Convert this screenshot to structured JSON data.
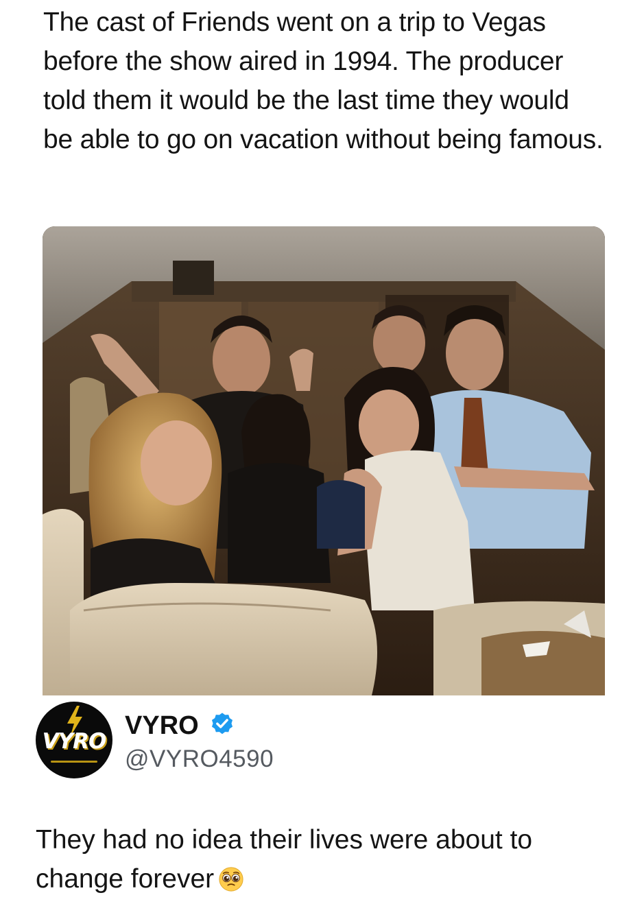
{
  "post": {
    "text": "The cast of Friends went on a trip to Vegas before the show aired in 1994. The producer told them it would be the last time they would be able to go on vacation without being famous."
  },
  "media": {
    "subject": "cast-photo"
  },
  "author": {
    "display_name": "VYRO",
    "handle": "@VYRO4590",
    "avatar_text": "VYRO",
    "verified": true
  },
  "caption": {
    "text": "They had no idea their lives were about to change forever",
    "emoji": "pleading-face-emoji"
  },
  "colors": {
    "verified_badge": "#1d9bf0",
    "avatar_bg": "#0a0a0a",
    "avatar_accent": "#e0b31a"
  }
}
